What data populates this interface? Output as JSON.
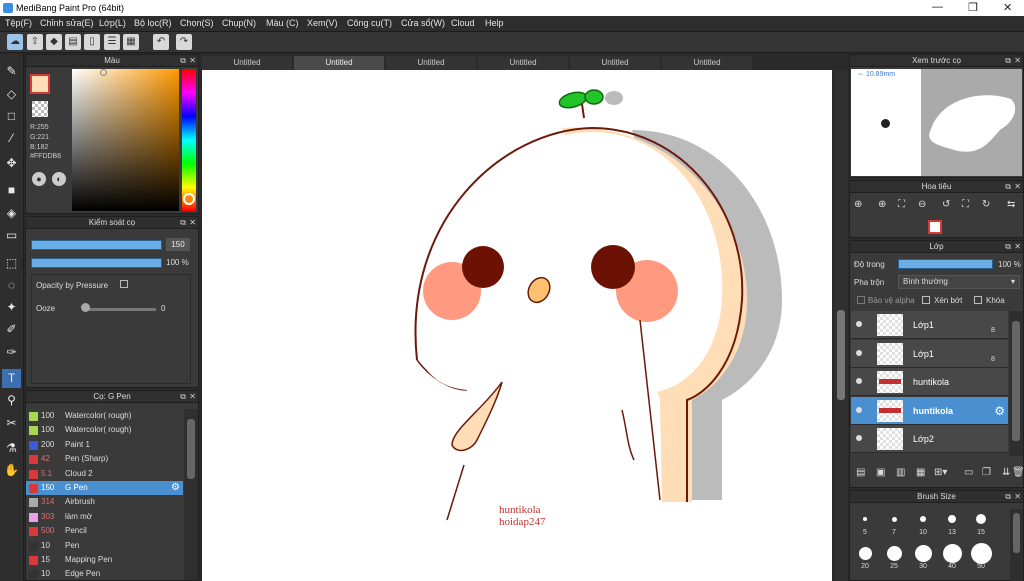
{
  "window": {
    "title": "MediBang Paint Pro (64bit)"
  },
  "menu": [
    "Tệp(F)",
    "Chỉnh sửa(E)",
    "Lớp(L)",
    "Bộ lọc(R)",
    "Chọn(S)",
    "Chụp(N)",
    "Màu (C)",
    "Xem(V)",
    "Công cụ(T)",
    "Cửa sổ(W)",
    "Cloud",
    "Help"
  ],
  "tabs": [
    "Untitled",
    "Untitled",
    "Untitled",
    "Untitled",
    "Untitled",
    "Untitled"
  ],
  "color_panel": {
    "title": "Màu",
    "r": "R:255",
    "g": "G:221",
    "b": "B:182",
    "hex": "#FFDDB6"
  },
  "brush_control": {
    "title": "Kiểm soát cọ",
    "size": "150",
    "opacity": "100 %",
    "opacity_by_pressure": "Opacity by Pressure",
    "ooze_label": "Ooze",
    "ooze_value": "0"
  },
  "brush_list": {
    "title": "Cọ: G Pen",
    "items": [
      {
        "n": "100",
        "label": "Watercolor( rough)",
        "color": "#a8d850"
      },
      {
        "n": "100",
        "label": "Watercolor( rough)",
        "color": "#a8d850"
      },
      {
        "n": "200",
        "label": "Paint 1",
        "color": "#3a5ad8"
      },
      {
        "n": "42",
        "label": "Pen (Sharp)",
        "color": "#d83a3a"
      },
      {
        "n": "5.1",
        "label": "Cloud 2",
        "color": "#d83a3a"
      },
      {
        "n": "150",
        "label": "G Pen",
        "color": "#d83a3a"
      },
      {
        "n": "314",
        "label": "Airbrush",
        "color": "#aaaaaa"
      },
      {
        "n": "303",
        "label": "làm mờ",
        "color": "#e8a0e8"
      },
      {
        "n": "500",
        "label": "Pencil",
        "color": "#d83a3a"
      },
      {
        "n": "10",
        "label": "Pen",
        "color": "#333333"
      },
      {
        "n": "15",
        "label": "Mapping Pen",
        "color": "#d83a3a"
      },
      {
        "n": "10",
        "label": "Edge Pen",
        "color": "#333333"
      }
    ]
  },
  "preview": {
    "title": "Xem trước cọ",
    "size": "10.89mm"
  },
  "navigator": {
    "title": "Hoa tiêu"
  },
  "layers": {
    "title": "Lớp",
    "opacity_label": "Độ trong",
    "opacity_value": "100 %",
    "blend_label": "Pha trộn",
    "blend_value": "Bình thường",
    "alpha_lock": "Bảo vệ alpha",
    "clipping": "Xén bớt",
    "lock": "Khóa",
    "items": [
      {
        "name": "Lớp1",
        "pct": "8"
      },
      {
        "name": "Lớp1",
        "pct": "8"
      },
      {
        "name": "huntikola",
        "pct": ""
      },
      {
        "name": "huntikola",
        "pct": ""
      },
      {
        "name": "Lớp2",
        "pct": ""
      }
    ]
  },
  "brush_size": {
    "title": "Brush Size",
    "sizes": [
      "5",
      "7",
      "10",
      "13",
      "15",
      "20",
      "25",
      "30",
      "40",
      "50"
    ]
  },
  "canvas_text": {
    "line1": "huntikola",
    "line2": "hoidap247"
  }
}
